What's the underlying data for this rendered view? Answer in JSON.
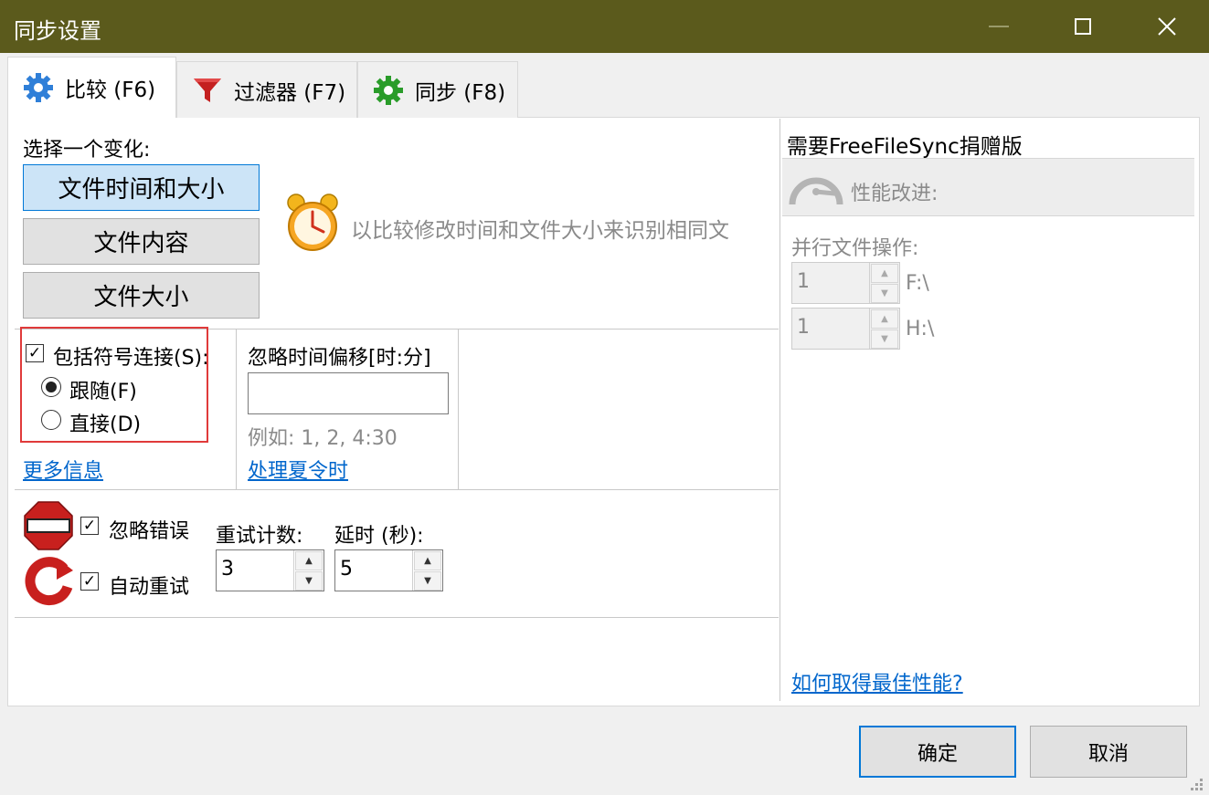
{
  "window": {
    "title": "同步设置",
    "minimize_glyph": "—",
    "maximize_glyph": "☐",
    "close_glyph": "✕"
  },
  "tabs": [
    {
      "label": "比较 (F6)",
      "icon": "gear-blue-icon",
      "active": true
    },
    {
      "label": "过滤器 (F7)",
      "icon": "funnel-icon",
      "active": false
    },
    {
      "label": "同步 (F8)",
      "icon": "gear-green-icon",
      "active": false
    }
  ],
  "compare": {
    "heading": "选择一个变化:",
    "options": [
      "文件时间和大小",
      "文件内容",
      "文件大小"
    ],
    "selected_index": 0,
    "description": "以比较修改时间和文件大小来识别相同文"
  },
  "symlinks": {
    "checkbox_label": "包括符号连接(S):",
    "checked": true,
    "radio_follow": "跟随(F)",
    "radio_direct": "直接(D)",
    "selected": "follow",
    "more_info_link": "更多信息"
  },
  "time_shift": {
    "label": "忽略时间偏移[时:分]",
    "value": "",
    "hint": "例如: 1, 2, 4:30",
    "dst_link": "处理夏令时"
  },
  "errors": {
    "ignore_errors_label": "忽略错误",
    "ignore_errors_checked": true,
    "auto_retry_label": "自动重试",
    "auto_retry_checked": true,
    "retry_count_label": "重试计数:",
    "retry_count_value": "3",
    "delay_label": "延时 (秒):",
    "delay_value": "5"
  },
  "donation": {
    "header": "需要FreeFileSync捐赠版",
    "perf_label": "性能改进:",
    "parallel_label": "并行文件操作:",
    "drives": [
      {
        "value": "1",
        "path": "F:\\"
      },
      {
        "value": "1",
        "path": "H:\\"
      }
    ],
    "perf_link": "如何取得最佳性能?"
  },
  "spin_up": "▲",
  "spin_down": "▼",
  "checkmark": "✓",
  "buttons": {
    "ok": "确定",
    "cancel": "取消"
  },
  "colors": {
    "titlebar": "#5b5a1c",
    "accent": "#0078d7",
    "link": "#0066cc",
    "highlight_border": "#e03a3a"
  }
}
